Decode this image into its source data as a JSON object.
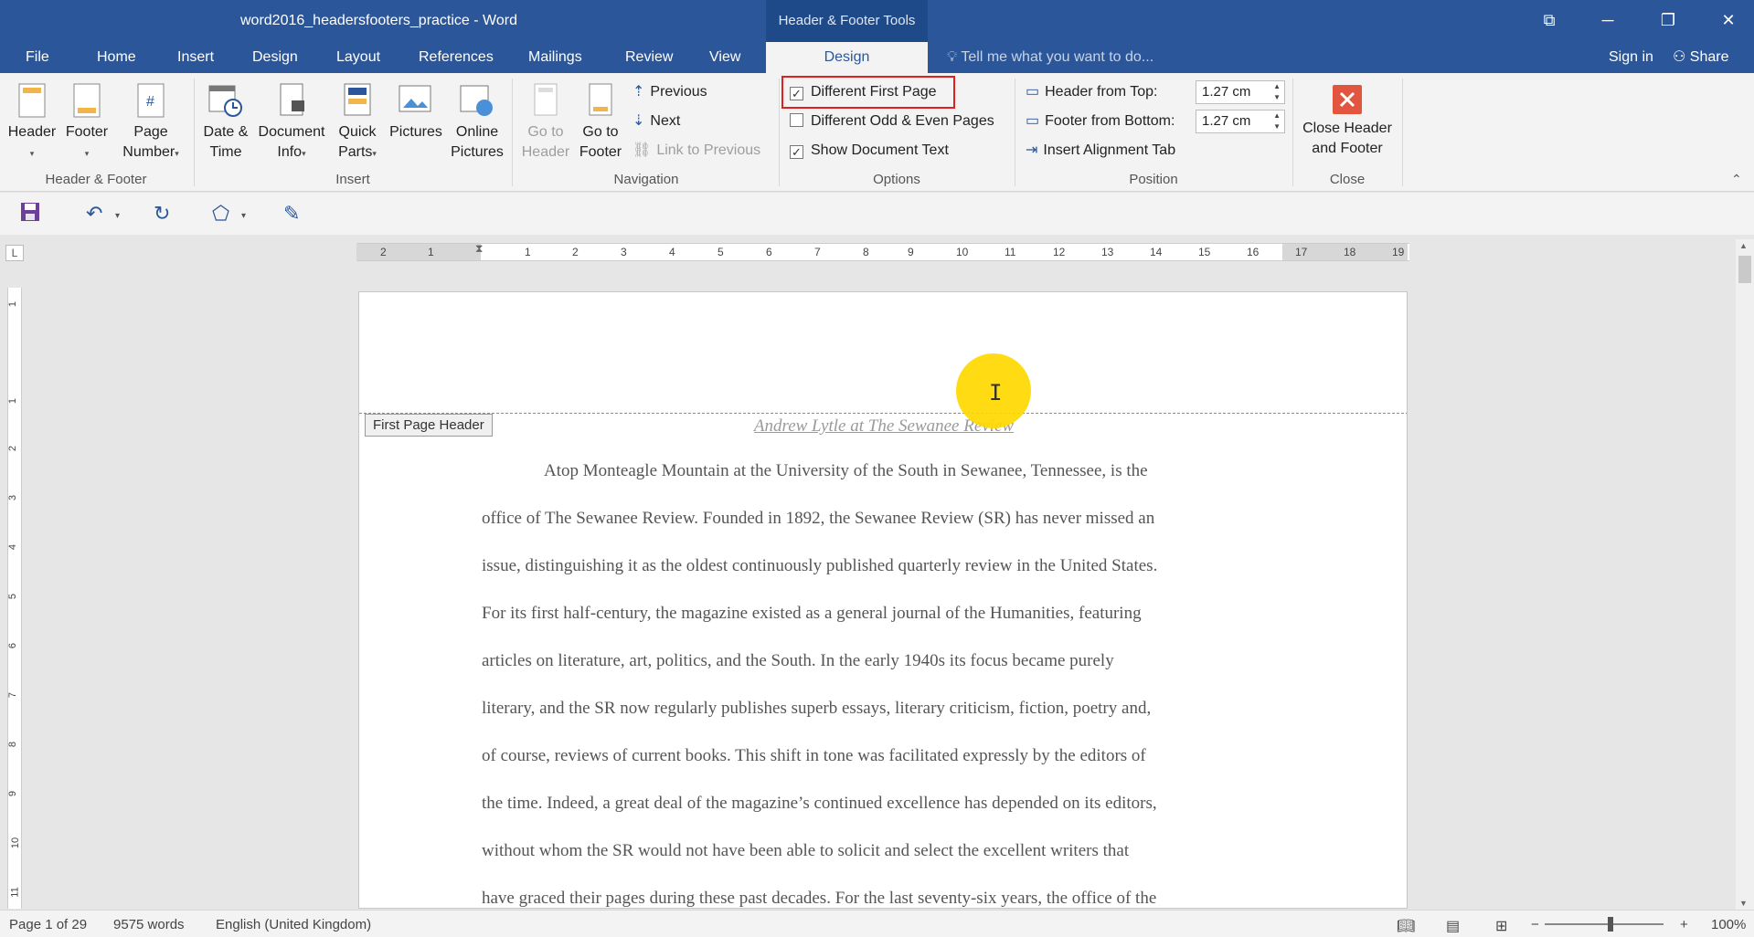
{
  "window": {
    "title": "word2016_headersfooters_practice - Word",
    "context_tab": "Header & Footer Tools"
  },
  "tabs": {
    "file": "File",
    "home": "Home",
    "insert": "Insert",
    "design": "Design",
    "layout": "Layout",
    "references": "References",
    "mailings": "Mailings",
    "review": "Review",
    "view": "View",
    "hf_design": "Design",
    "tellme": "Tell me what you want to do...",
    "signin": "Sign in",
    "share": "Share"
  },
  "ribbon": {
    "header": "Header",
    "footer": "Footer",
    "page_number_1": "Page",
    "page_number_2": "Number",
    "group_hf": "Header & Footer",
    "date_1": "Date &",
    "date_2": "Time",
    "docinfo_1": "Document",
    "docinfo_2": "Info",
    "quick_1": "Quick",
    "quick_2": "Parts",
    "pictures": "Pictures",
    "online_1": "Online",
    "online_2": "Pictures",
    "group_insert": "Insert",
    "goto_header_1": "Go to",
    "goto_header_2": "Header",
    "goto_footer_1": "Go to",
    "goto_footer_2": "Footer",
    "previous": "Previous",
    "next": "Next",
    "link_prev": "Link to Previous",
    "group_nav": "Navigation",
    "diff_first": "Different First Page",
    "diff_oddeven": "Different Odd & Even Pages",
    "show_doc": "Show Document Text",
    "group_options": "Options",
    "header_top": "Header from Top:",
    "header_top_val": "1.27 cm",
    "footer_bottom": "Footer from Bottom:",
    "footer_bottom_val": "1.27 cm",
    "align_tab": "Insert Alignment Tab",
    "group_position": "Position",
    "close_1": "Close Header",
    "close_2": "and Footer",
    "group_close": "Close"
  },
  "ruler": {
    "corner": "L",
    "h_numbers": [
      "2",
      "1",
      "1",
      "2",
      "3",
      "4",
      "5",
      "6",
      "7",
      "8",
      "9",
      "10",
      "11",
      "12",
      "13",
      "14",
      "15",
      "16",
      "17",
      "18",
      "19"
    ],
    "v_numbers": [
      "1",
      "1",
      "2",
      "3",
      "4",
      "5",
      "6",
      "7",
      "8",
      "9",
      "10",
      "11"
    ]
  },
  "document": {
    "header_tag": "First Page Header",
    "header_text": "Andrew Lytle at The Sewanee Review",
    "lines": [
      "Atop Monteagle Mountain at the University of the South in Sewanee, Tennessee, is the",
      "office of The Sewanee Review. Founded in 1892, the Sewanee Review (SR) has never missed an",
      "issue, distinguishing it as the oldest continuously published quarterly review in the United States.",
      "For its first half-century, the magazine existed as a general journal of the Humanities, featuring",
      "articles on literature, art, politics, and the South. In the early 1940s its focus became purely",
      "literary, and the SR now regularly publishes superb essays, literary criticism, fiction, poetry and,",
      "of course, reviews of current books. This shift in tone was facilitated expressly by the editors of",
      "the time. Indeed, a great deal of the magazine’s continued excellence has depended on its editors,",
      "without whom the SR would not have been able to solicit and select the excellent writers that",
      "have graced their pages during these past decades. For the last seventy-six years, the office of the"
    ]
  },
  "status": {
    "page": "Page 1 of 29",
    "words": "9575 words",
    "language": "English (United Kingdom)",
    "zoom": "100%"
  }
}
